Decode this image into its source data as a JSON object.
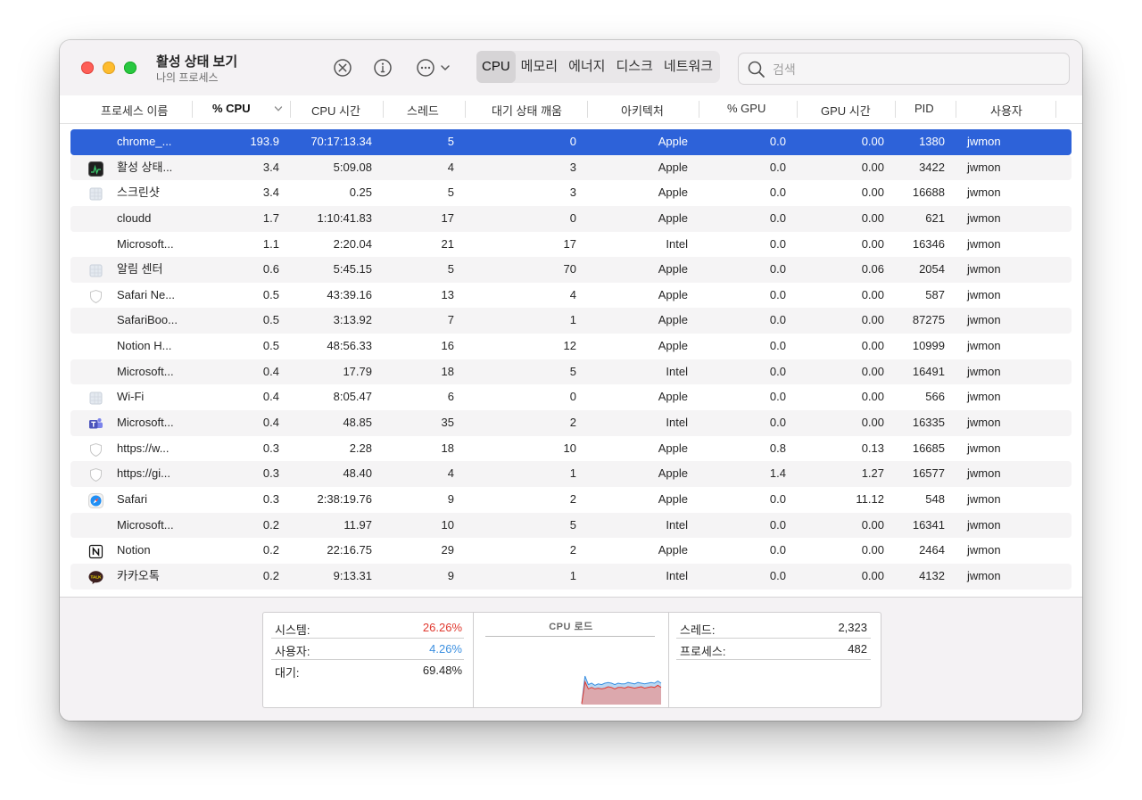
{
  "app": {
    "title": "활성 상태 보기",
    "subtitle": "나의 프로세스"
  },
  "toolbar": {
    "icons": [
      "stop-process-icon",
      "info-icon",
      "more-options-icon",
      "chevron-down-icon"
    ],
    "tabs": [
      "CPU",
      "메모리",
      "에너지",
      "디스크",
      "네트워크"
    ],
    "active_tab": "CPU",
    "search_placeholder": "검색"
  },
  "table": {
    "columns": [
      "프로세스 이름",
      "% CPU",
      "CPU 시간",
      "스레드",
      "대기 상태 깨움",
      "아키텍처",
      "% GPU",
      "GPU 시간",
      "PID",
      "사용자"
    ],
    "sorted_column": "% CPU",
    "rows": [
      {
        "icon": "none",
        "name": "chrome_...",
        "cpu": "193.9",
        "cpu_time": "70:17:13.34",
        "threads": "5",
        "wakeups": "0",
        "arch": "Apple",
        "gpu": "0.0",
        "gpu_time": "0.00",
        "pid": "1380",
        "user": "jwmon",
        "selected": true
      },
      {
        "icon": "activity-monitor-icon",
        "name": "활성 상태...",
        "cpu": "3.4",
        "cpu_time": "5:09.08",
        "threads": "4",
        "wakeups": "3",
        "arch": "Apple",
        "gpu": "0.0",
        "gpu_time": "0.00",
        "pid": "3422",
        "user": "jwmon"
      },
      {
        "icon": "generic-app-icon",
        "name": "스크린샷",
        "cpu": "3.4",
        "cpu_time": "0.25",
        "threads": "5",
        "wakeups": "3",
        "arch": "Apple",
        "gpu": "0.0",
        "gpu_time": "0.00",
        "pid": "16688",
        "user": "jwmon"
      },
      {
        "icon": "none",
        "name": "cloudd",
        "cpu": "1.7",
        "cpu_time": "1:10:41.83",
        "threads": "17",
        "wakeups": "0",
        "arch": "Apple",
        "gpu": "0.0",
        "gpu_time": "0.00",
        "pid": "621",
        "user": "jwmon"
      },
      {
        "icon": "none",
        "name": "Microsoft...",
        "cpu": "1.1",
        "cpu_time": "2:20.04",
        "threads": "21",
        "wakeups": "17",
        "arch": "Intel",
        "gpu": "0.0",
        "gpu_time": "0.00",
        "pid": "16346",
        "user": "jwmon"
      },
      {
        "icon": "generic-app-icon",
        "name": "알림 센터",
        "cpu": "0.6",
        "cpu_time": "5:45.15",
        "threads": "5",
        "wakeups": "70",
        "arch": "Apple",
        "gpu": "0.0",
        "gpu_time": "0.06",
        "pid": "2054",
        "user": "jwmon"
      },
      {
        "icon": "shield-icon",
        "name": "Safari Ne...",
        "cpu": "0.5",
        "cpu_time": "43:39.16",
        "threads": "13",
        "wakeups": "4",
        "arch": "Apple",
        "gpu": "0.0",
        "gpu_time": "0.00",
        "pid": "587",
        "user": "jwmon"
      },
      {
        "icon": "none",
        "name": "SafariBoo...",
        "cpu": "0.5",
        "cpu_time": "3:13.92",
        "threads": "7",
        "wakeups": "1",
        "arch": "Apple",
        "gpu": "0.0",
        "gpu_time": "0.00",
        "pid": "87275",
        "user": "jwmon"
      },
      {
        "icon": "none",
        "name": "Notion H...",
        "cpu": "0.5",
        "cpu_time": "48:56.33",
        "threads": "16",
        "wakeups": "12",
        "arch": "Apple",
        "gpu": "0.0",
        "gpu_time": "0.00",
        "pid": "10999",
        "user": "jwmon"
      },
      {
        "icon": "none",
        "name": "Microsoft...",
        "cpu": "0.4",
        "cpu_time": "17.79",
        "threads": "18",
        "wakeups": "5",
        "arch": "Intel",
        "gpu": "0.0",
        "gpu_time": "0.00",
        "pid": "16491",
        "user": "jwmon"
      },
      {
        "icon": "generic-app-icon",
        "name": "Wi-Fi",
        "cpu": "0.4",
        "cpu_time": "8:05.47",
        "threads": "6",
        "wakeups": "0",
        "arch": "Apple",
        "gpu": "0.0",
        "gpu_time": "0.00",
        "pid": "566",
        "user": "jwmon"
      },
      {
        "icon": "teams-icon",
        "name": "Microsoft...",
        "cpu": "0.4",
        "cpu_time": "48.85",
        "threads": "35",
        "wakeups": "2",
        "arch": "Intel",
        "gpu": "0.0",
        "gpu_time": "0.00",
        "pid": "16335",
        "user": "jwmon"
      },
      {
        "icon": "shield-icon",
        "name": "https://w...",
        "cpu": "0.3",
        "cpu_time": "2.28",
        "threads": "18",
        "wakeups": "10",
        "arch": "Apple",
        "gpu": "0.8",
        "gpu_time": "0.13",
        "pid": "16685",
        "user": "jwmon"
      },
      {
        "icon": "shield-icon",
        "name": "https://gi...",
        "cpu": "0.3",
        "cpu_time": "48.40",
        "threads": "4",
        "wakeups": "1",
        "arch": "Apple",
        "gpu": "1.4",
        "gpu_time": "1.27",
        "pid": "16577",
        "user": "jwmon"
      },
      {
        "icon": "safari-icon",
        "name": "Safari",
        "cpu": "0.3",
        "cpu_time": "2:38:19.76",
        "threads": "9",
        "wakeups": "2",
        "arch": "Apple",
        "gpu": "0.0",
        "gpu_time": "11.12",
        "pid": "548",
        "user": "jwmon"
      },
      {
        "icon": "none",
        "name": "Microsoft...",
        "cpu": "0.2",
        "cpu_time": "11.97",
        "threads": "10",
        "wakeups": "5",
        "arch": "Intel",
        "gpu": "0.0",
        "gpu_time": "0.00",
        "pid": "16341",
        "user": "jwmon"
      },
      {
        "icon": "notion-icon",
        "name": "Notion",
        "cpu": "0.2",
        "cpu_time": "22:16.75",
        "threads": "29",
        "wakeups": "2",
        "arch": "Apple",
        "gpu": "0.0",
        "gpu_time": "0.00",
        "pid": "2464",
        "user": "jwmon"
      },
      {
        "icon": "kakaotalk-icon",
        "name": "카카오톡",
        "cpu": "0.2",
        "cpu_time": "9:13.31",
        "threads": "9",
        "wakeups": "1",
        "arch": "Intel",
        "gpu": "0.0",
        "gpu_time": "0.00",
        "pid": "4132",
        "user": "jwmon"
      }
    ]
  },
  "footer": {
    "system_label": "시스템:",
    "system_value": "26.26%",
    "user_label": "사용자:",
    "user_value": "4.26%",
    "idle_label": "대기:",
    "idle_value": "69.48%",
    "chart_title": "CPU 로드",
    "threads_label": "스레드:",
    "threads_value": "2,323",
    "processes_label": "프로세스:",
    "processes_value": "482",
    "colors": {
      "system": "#e0392f",
      "user": "#3b8fe0"
    },
    "cpu_load_system_percent": [
      1,
      32,
      22,
      24,
      22,
      23,
      22,
      23,
      25,
      24,
      22,
      24,
      24,
      23,
      25,
      24,
      23,
      24,
      25,
      23,
      24,
      25,
      24,
      27,
      24
    ],
    "cpu_load_total_percent": [
      1,
      40,
      28,
      30,
      27,
      29,
      28,
      30,
      31,
      30,
      28,
      30,
      29,
      29,
      31,
      30,
      29,
      31,
      30,
      29,
      30,
      31,
      30,
      33,
      30
    ]
  }
}
